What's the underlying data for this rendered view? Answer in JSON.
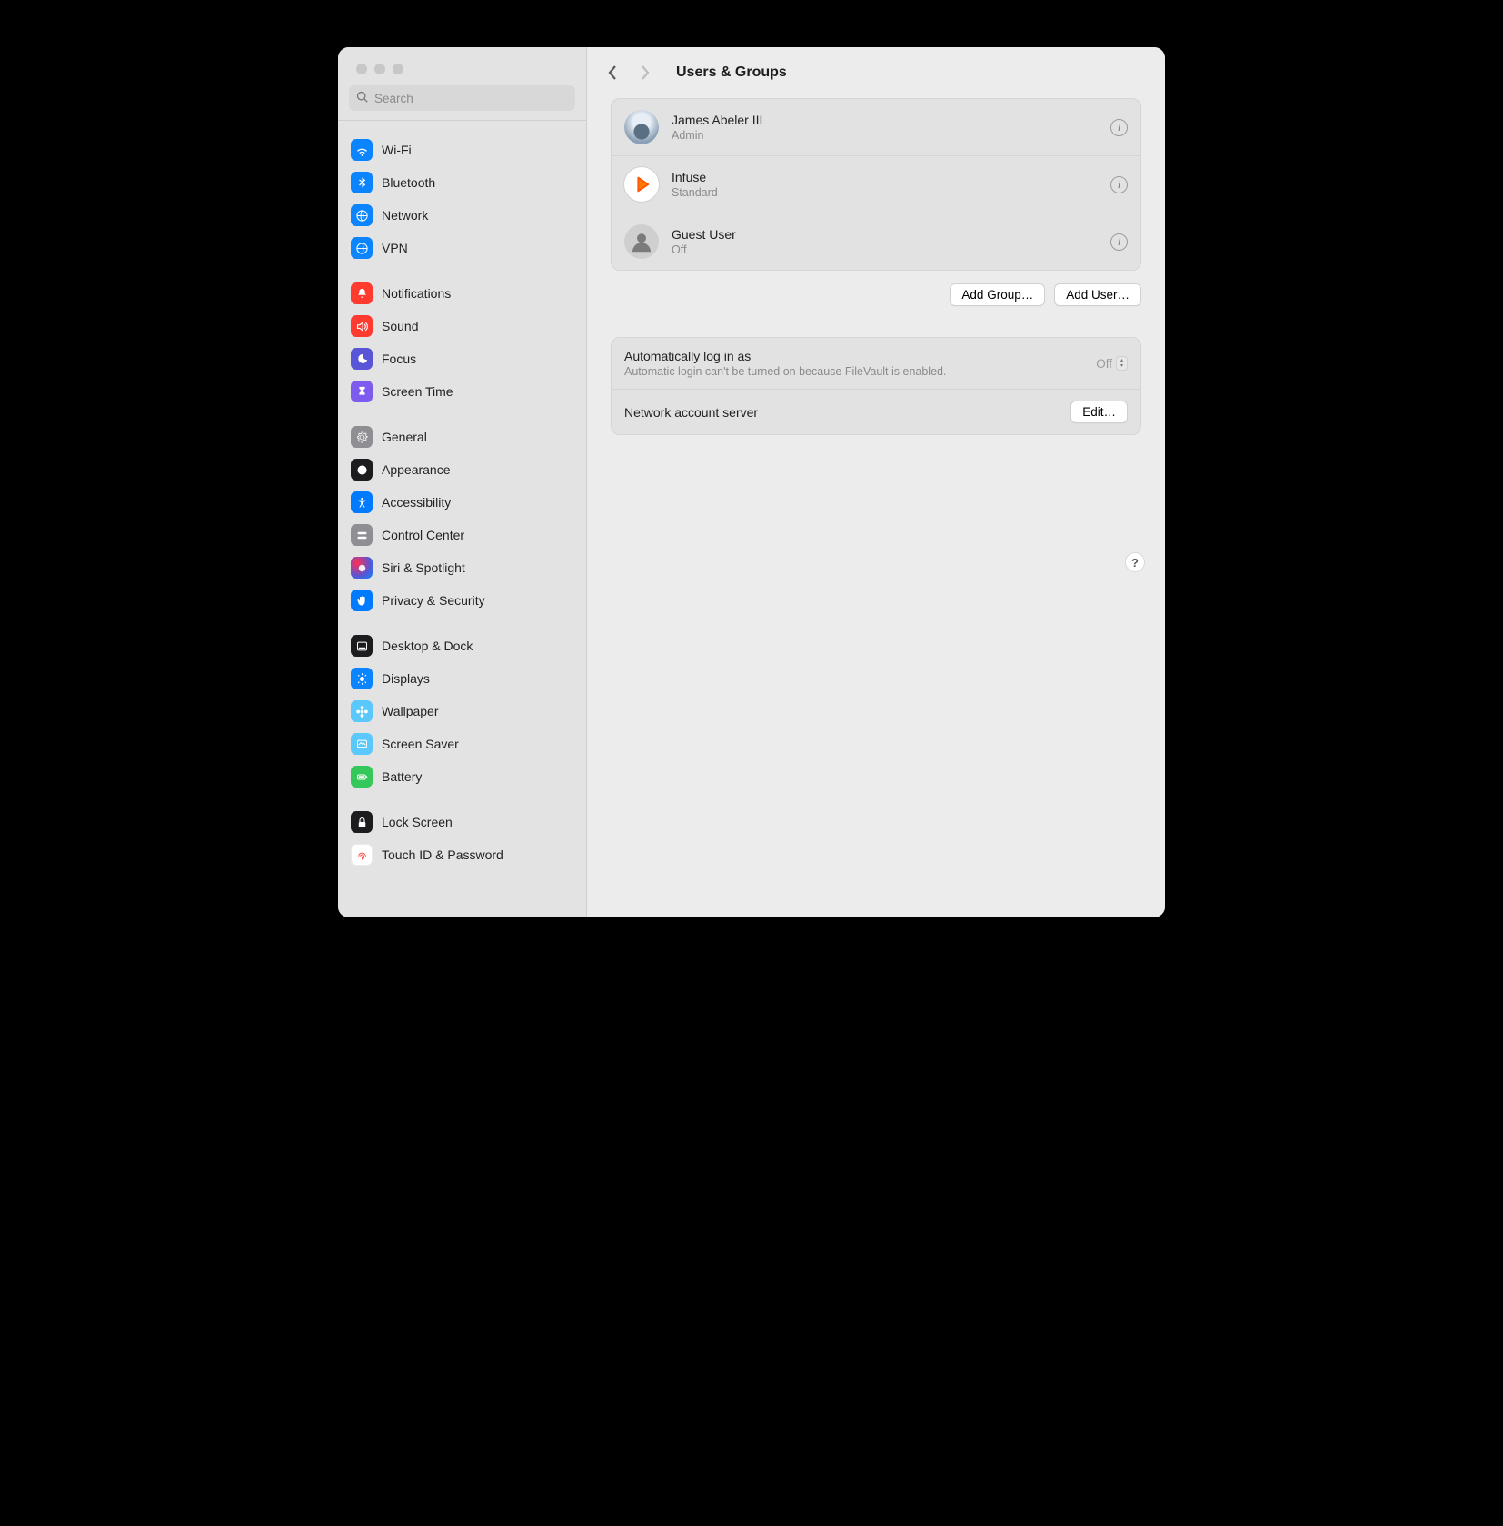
{
  "window": {
    "title": "Users & Groups",
    "search_placeholder": "Search"
  },
  "sidebar": {
    "groups": [
      {
        "items": [
          {
            "label": "Wi-Fi",
            "icon": "wifi-icon",
            "color": "blue"
          },
          {
            "label": "Bluetooth",
            "icon": "bluetooth-icon",
            "color": "blue"
          },
          {
            "label": "Network",
            "icon": "network-icon",
            "color": "blue"
          },
          {
            "label": "VPN",
            "icon": "vpn-icon",
            "color": "blue"
          }
        ]
      },
      {
        "items": [
          {
            "label": "Notifications",
            "icon": "bell-icon",
            "color": "red"
          },
          {
            "label": "Sound",
            "icon": "speaker-icon",
            "color": "red"
          },
          {
            "label": "Focus",
            "icon": "moon-icon",
            "color": "purple"
          },
          {
            "label": "Screen Time",
            "icon": "hourglass-icon",
            "color": "violet"
          }
        ]
      },
      {
        "items": [
          {
            "label": "General",
            "icon": "gear-icon",
            "color": "gray"
          },
          {
            "label": "Appearance",
            "icon": "appearance-icon",
            "color": "black"
          },
          {
            "label": "Accessibility",
            "icon": "accessibility-icon",
            "color": "blue2"
          },
          {
            "label": "Control Center",
            "icon": "switches-icon",
            "color": "gray"
          },
          {
            "label": "Siri & Spotlight",
            "icon": "siri-icon",
            "color": "siri"
          },
          {
            "label": "Privacy & Security",
            "icon": "hand-icon",
            "color": "blue2"
          }
        ]
      },
      {
        "items": [
          {
            "label": "Desktop & Dock",
            "icon": "dock-icon",
            "color": "black"
          },
          {
            "label": "Displays",
            "icon": "sun-icon",
            "color": "blue"
          },
          {
            "label": "Wallpaper",
            "icon": "flower-icon",
            "color": "teal"
          },
          {
            "label": "Screen Saver",
            "icon": "screensaver-icon",
            "color": "teal"
          },
          {
            "label": "Battery",
            "icon": "battery-icon",
            "color": "green"
          }
        ]
      },
      {
        "items": [
          {
            "label": "Lock Screen",
            "icon": "lock-icon",
            "color": "black"
          },
          {
            "label": "Touch ID & Password",
            "icon": "fingerprint-icon",
            "color": "white"
          }
        ]
      }
    ]
  },
  "users": [
    {
      "name": "James Abeler III",
      "role": "Admin",
      "avatar": "photo"
    },
    {
      "name": "Infuse",
      "role": "Standard",
      "avatar": "infuse"
    },
    {
      "name": "Guest User",
      "role": "Off",
      "avatar": "guest"
    }
  ],
  "actions": {
    "add_group": "Add Group…",
    "add_user": "Add User…"
  },
  "settings": {
    "auto_login": {
      "title": "Automatically log in as",
      "note": "Automatic login can't be turned on because FileVault is enabled.",
      "value": "Off"
    },
    "network_server": {
      "title": "Network account server",
      "button": "Edit…"
    }
  },
  "help_label": "?"
}
